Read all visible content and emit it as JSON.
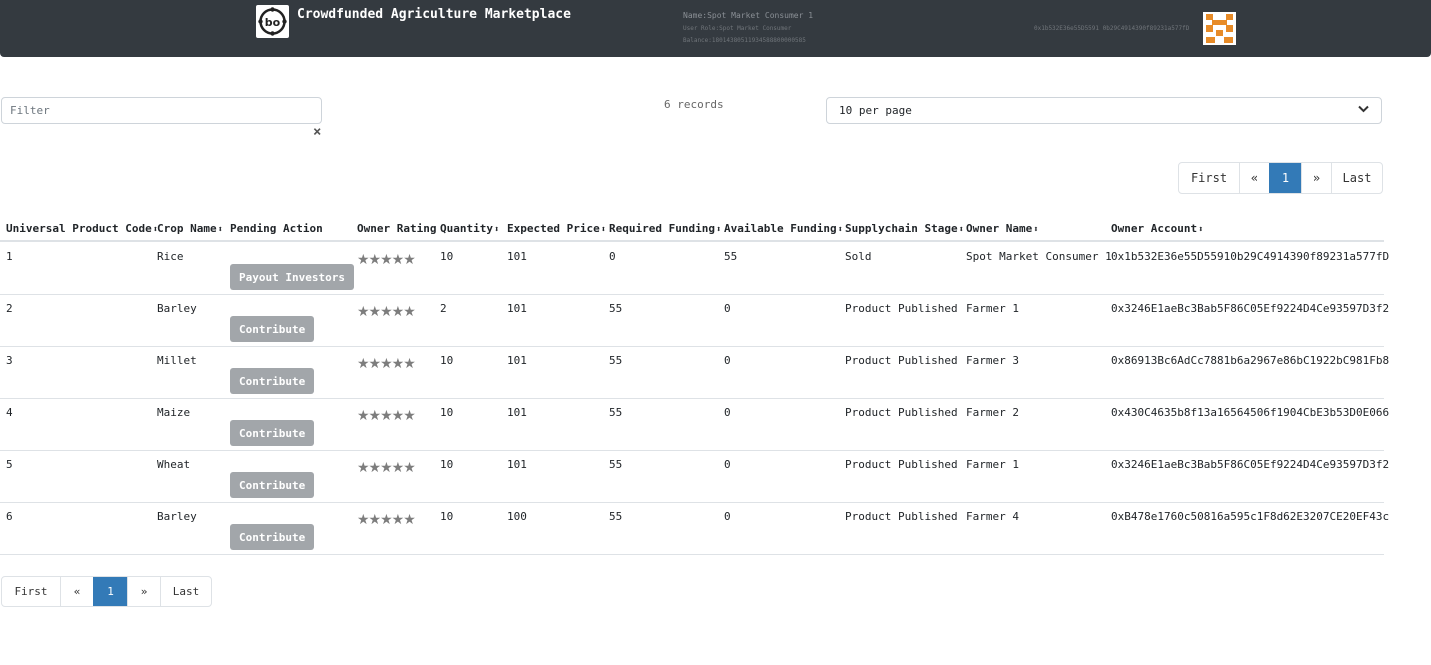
{
  "navbar": {
    "brand": "Crowdfunded Agriculture Marketplace",
    "user_name": "Name:Spot Market Consumer 1",
    "user_role": "User Role:Spot Market Consumer",
    "balance": "Balance:18014380511934588800000585",
    "account": "0x1b532E36e55D5591 0b29C4914390f89231a577fD",
    "logo_icon": "blockchain-logo-icon",
    "avatar_icon": "identicon-avatar",
    "accent_color": "#e78b28"
  },
  "filter": {
    "placeholder": "Filter",
    "value": "",
    "clear": "×"
  },
  "records": "6 records",
  "per_page": {
    "selected": "10 per page"
  },
  "pagination": {
    "first": "First",
    "prev": "«",
    "current": "1",
    "next": "»",
    "last": "Last"
  },
  "table": {
    "headers": [
      "Universal Product Code",
      "Crop Name",
      "Pending Action",
      "Owner Rating",
      "Quantity",
      "Expected Price",
      "Required Funding",
      "Available Funding",
      "Supplychain Stage",
      "Owner Name",
      "Owner Account"
    ],
    "sort_icon": "⬍",
    "rows": [
      {
        "upc": "1",
        "crop": "Rice",
        "action": "Payout Investors",
        "rating": "★★★★★",
        "qty": "10",
        "price": "101",
        "req": "0",
        "avail": "55",
        "stage": "Sold",
        "owner": "Spot Market Consumer 1",
        "account": "0x1b532E36e55D55910b29C4914390f89231a577fD"
      },
      {
        "upc": "2",
        "crop": "Barley",
        "action": "Contribute",
        "rating": "★★★★★",
        "qty": "2",
        "price": "101",
        "req": "55",
        "avail": "0",
        "stage": "Product Published",
        "owner": "Farmer 1",
        "account": "0x3246E1aeBc3Bab5F86C05Ef9224D4Ce93597D3f2"
      },
      {
        "upc": "3",
        "crop": "Millet",
        "action": "Contribute",
        "rating": "★★★★★",
        "qty": "10",
        "price": "101",
        "req": "55",
        "avail": "0",
        "stage": "Product Published",
        "owner": "Farmer 3",
        "account": "0x86913Bc6AdCc7881b6a2967e86bC1922bC981Fb8"
      },
      {
        "upc": "4",
        "crop": "Maize",
        "action": "Contribute",
        "rating": "★★★★★",
        "qty": "10",
        "price": "101",
        "req": "55",
        "avail": "0",
        "stage": "Product Published",
        "owner": "Farmer 2",
        "account": "0x430C4635b8f13a16564506f1904CbE3b53D0E066"
      },
      {
        "upc": "5",
        "crop": "Wheat",
        "action": "Contribute",
        "rating": "★★★★★",
        "qty": "10",
        "price": "101",
        "req": "55",
        "avail": "0",
        "stage": "Product Published",
        "owner": "Farmer 1",
        "account": "0x3246E1aeBc3Bab5F86C05Ef9224D4Ce93597D3f2"
      },
      {
        "upc": "6",
        "crop": "Barley",
        "action": "Contribute",
        "rating": "★★★★★",
        "qty": "10",
        "price": "100",
        "req": "55",
        "avail": "0",
        "stage": "Product Published",
        "owner": "Farmer 4",
        "account": "0xB478e1760c50816a595c1F8d62E3207CE20EF43c"
      }
    ]
  }
}
